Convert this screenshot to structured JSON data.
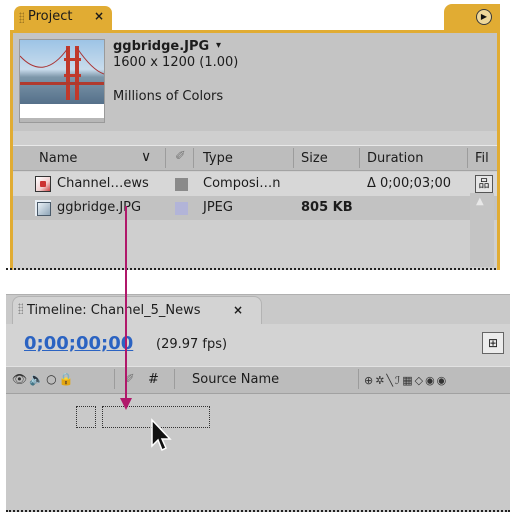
{
  "project_panel": {
    "tab_title": "Project",
    "tab_close": "×",
    "flyout": "▶",
    "file_name": "ggbridge.JPG",
    "file_name_caret": "▾",
    "dimensions": "1600 x 1200 (1.00)",
    "color_depth": "Millions of Colors",
    "columns": {
      "name": "Name",
      "sort_caret": "∨",
      "label_icon": "tag-icon",
      "type": "Type",
      "size": "Size",
      "duration": "Duration",
      "file": "Fil"
    },
    "rows": [
      {
        "name": "Channel…ews",
        "icon": "composition-icon",
        "label_color": "#8a8a8a",
        "type": "Composi…n",
        "size": "",
        "duration": "Δ 0;00;03;00",
        "extra_icon": "flowchart-icon",
        "extra_glyph": "品"
      },
      {
        "name": "ggbridge.JPG",
        "icon": "jpeg-file-icon",
        "label_color": "#b2b4d8",
        "type": "JPEG",
        "size": "805 KB",
        "duration": ""
      }
    ],
    "scroll_up": "▲",
    "accent_color": "#e1ac33"
  },
  "timeline_panel": {
    "tab_title": "Timeline: Channel_5_News",
    "tab_close": "×",
    "timecode": "0;00;00;00",
    "fps": "(29.97 fps)",
    "comp_button_glyph": "⊞",
    "columns": {
      "av_icons": "👁🔈○🔒",
      "label_icon": "tag-icon",
      "hash": "#",
      "source_name": "Source Name",
      "switches": "⊕✲╲ℐ▦◇◉◉"
    },
    "timecode_color": "#2b63c2"
  }
}
